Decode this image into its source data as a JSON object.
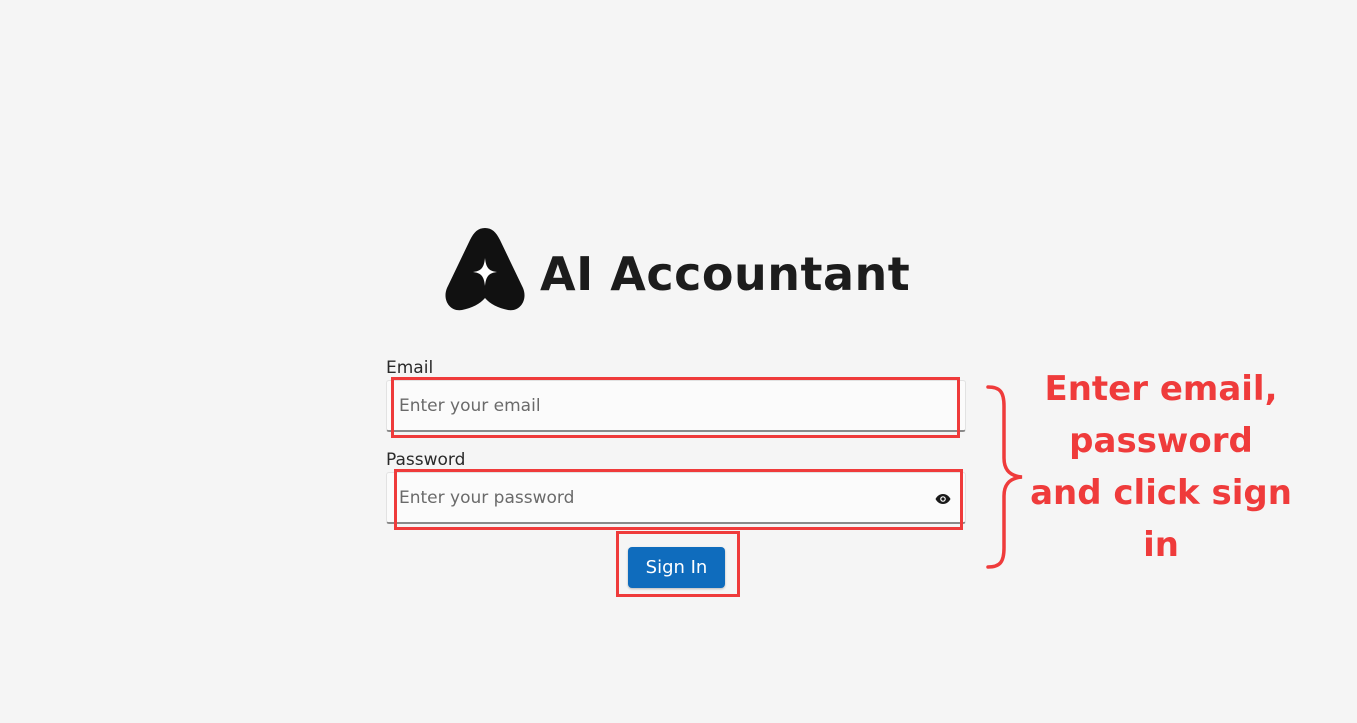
{
  "app": {
    "title": "AI Accountant",
    "logo_icon": "ai-accountant-logo-icon"
  },
  "form": {
    "email": {
      "label": "Email",
      "placeholder": "Enter your email",
      "value": ""
    },
    "password": {
      "label": "Password",
      "placeholder": "Enter your password",
      "value": "",
      "toggle_icon": "eye-icon"
    },
    "submit_label": "Sign In"
  },
  "annotation": {
    "text": "Enter email, password and click sign in",
    "color": "#ef3b3b"
  },
  "colors": {
    "primary_button": "#0f6cbd",
    "background": "#f5f5f5"
  }
}
